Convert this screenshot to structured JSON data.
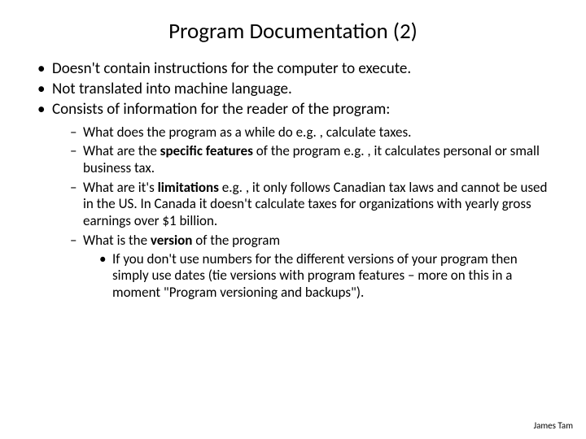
{
  "title": "Program Documentation (2)",
  "bullets": {
    "b1": "Doesn't contain instructions for the computer to execute.",
    "b2": "Not translated into machine language.",
    "b3": "Consists of information for the reader of the program:"
  },
  "sub": {
    "s1_pre": "What does the program as a while do e.g. , calculate taxes.",
    "s2_a": "What are the ",
    "s2_bold": "specific features",
    "s2_b": " of the program e.g. , it calculates personal or small business tax.",
    "s3_a": "What are it's ",
    "s3_bold": "limitations",
    "s3_b": " e.g. , it only follows Canadian tax laws and cannot be used in the US. In Canada it doesn't calculate taxes for organizations with yearly gross earnings over $1 billion.",
    "s4_a": "What is the ",
    "s4_bold": "version",
    "s4_b": " of the program"
  },
  "subsub": {
    "v1": "If you don't use numbers for the different versions of your program then simply use dates (tie versions with program features – more on this in a moment \"Program versioning and backups\")."
  },
  "footer": "James Tam"
}
